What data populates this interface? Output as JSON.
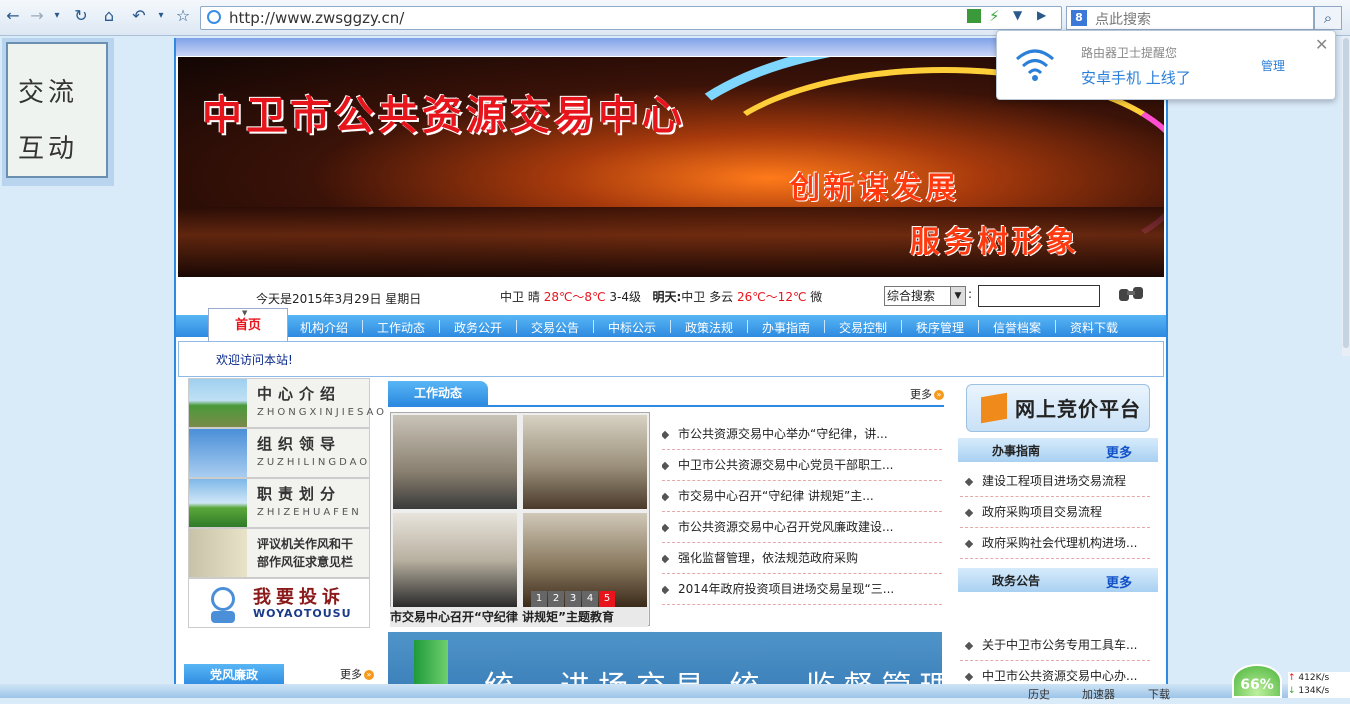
{
  "browser": {
    "url": "http://www.zwsggzy.cn/",
    "search_placeholder": "点此搜索",
    "search_engine_letter": "8"
  },
  "popup": {
    "title": "路由器卫士提醒您",
    "message": "安卓手机 上线了",
    "manage": "管理",
    "close": "✕"
  },
  "float_widget": {
    "line1": "交流",
    "line2": "互动"
  },
  "banner": {
    "title": "中卫市公共资源交易中心",
    "slogan1": "创新谋发展",
    "slogan2": "服务树形象"
  },
  "info_bar": {
    "date": "今天是2015年3月29日 星期日",
    "today_city": "中卫",
    "today_weather": "晴",
    "today_temp": "28℃～8℃",
    "today_wind": "3-4级",
    "tomorrow_label": "明天:",
    "tomorrow_city": "中卫",
    "tomorrow_weather": "多云",
    "tomorrow_temp": "26℃～12℃",
    "tomorrow_wind": "微",
    "search_select": "综合搜索",
    "search_colon": ":"
  },
  "nav": {
    "home": "首页",
    "items": [
      "机构介绍",
      "工作动态",
      "政务公开",
      "交易公告",
      "中标公示",
      "政策法规",
      "办事指南",
      "交易控制",
      "秩序管理",
      "信誉档案",
      "资料下载"
    ]
  },
  "welcome": "欢迎访问本站!",
  "left_column": {
    "blocks": [
      {
        "title": "中心介绍",
        "subtitle": "ZHONGXINJIESAO"
      },
      {
        "title": "组织领导",
        "subtitle": "ZUZHILINGDAO"
      },
      {
        "title": "职责划分",
        "subtitle": "ZHIZEHUAFEN"
      },
      {
        "title": "评议机关作风和干部作风征求意见栏",
        "subtitle": ""
      }
    ],
    "complain_title": "我要投诉",
    "complain_sub": "WOYAOTOUSU",
    "dangfeng_tab": "党风廉政",
    "more": "更多"
  },
  "work_news": {
    "tab": "工作动态",
    "more": "更多",
    "photo_caption": "市交易中心召开“守纪律 讲规矩”主题教育",
    "pager": [
      "1",
      "2",
      "3",
      "4",
      "5"
    ],
    "active_page": "5",
    "items": [
      "市公共资源交易中心举办“守纪律，讲...",
      "中卫市公共资源交易中心党员干部职工...",
      "市交易中心召开“守纪律 讲规矩”主...",
      "市公共资源交易中心召开党风廉政建设...",
      "强化监督管理，依法规范政府采购",
      "2014年政府投资项目进场交易呈现“三..."
    ],
    "banner_text": "统一进场交易 统一监督管理"
  },
  "right_column": {
    "platform": "网上竞价平台",
    "guide_title": "办事指南",
    "guide_more": "更多",
    "guide_items": [
      "建设工程项目进场交易流程",
      "政府采购项目交易流程",
      "政府采购社会代理机构进场..."
    ],
    "affairs_title": "政务公告",
    "affairs_more": "更多",
    "affairs_items": [
      "关于中卫市公务专用工具车...",
      "中卫市公共资源交易中心办..."
    ]
  },
  "system": {
    "gauge": "66%",
    "net_up": "412K/s",
    "net_down": "134K/s",
    "status1": "历史",
    "status2": "加速器",
    "status3": "下载"
  },
  "colors": {
    "nav_blue": "#2d8ae0",
    "title_red": "#e8141c",
    "link_blue": "#1252c8"
  }
}
